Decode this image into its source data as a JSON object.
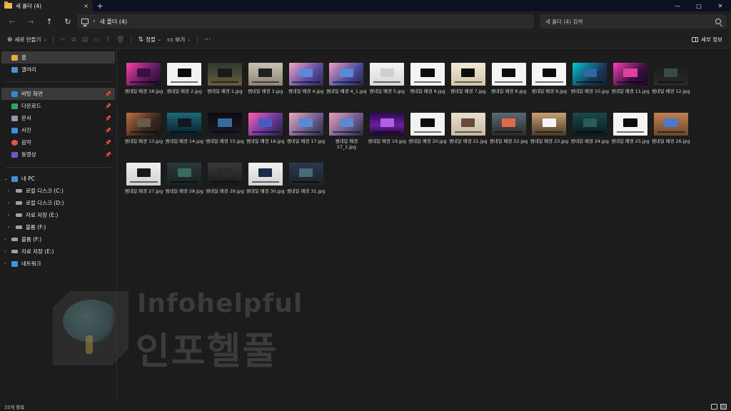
{
  "window": {
    "tab_title": "새 폴더 (4)",
    "tab_close": "×",
    "new_tab": "+",
    "minimize": "—",
    "maximize": "□",
    "close": "✕"
  },
  "address": {
    "back": "←",
    "forward": "→",
    "up": "↑",
    "refresh": "↻",
    "separator": "›",
    "crumb": "새 폴더 (4)",
    "search_placeholder": "새 폴더 (4) 검색"
  },
  "toolbar": {
    "new_label": "새로 만들기",
    "new_glyph": "⊕",
    "cut_glyph": "✂",
    "copy_glyph": "⧉",
    "paste_glyph": "▤",
    "rename_glyph": "▭",
    "share_glyph": "⇪",
    "delete_glyph": "🗑",
    "sort_label": "정렬",
    "sort_glyph": "⇅",
    "view_label": "보기",
    "view_glyph": "▭",
    "more": "···",
    "caret": "⌄",
    "details_label": "세부 정보"
  },
  "sidebar": {
    "home": "홈",
    "gallery": "갤러리",
    "desktop": "바탕 화면",
    "downloads": "다운로드",
    "documents": "문서",
    "pictures": "사진",
    "music": "음악",
    "videos": "동영상",
    "this_pc": "내 PC",
    "drive_c": "로컬 디스크 (C:)",
    "drive_d": "로컬 디스크 (D:)",
    "drive_e": "자료 저장 (E:)",
    "drive_f": "볼륨 (F:)",
    "drive_f2": "볼륨 (F:)",
    "drive_e2": "자료 저장 (E:)",
    "network": "네트워크",
    "pin": "📌",
    "chev_right": "›",
    "chev_down": "⌄",
    "colors": {
      "home": "#e8a848",
      "gallery": "#4a8fd6",
      "desktop": "#3a86d4",
      "downloads": "#2ea36b",
      "documents": "#8d9aa8",
      "pictures": "#3d8ed8",
      "music": "#e0584c",
      "videos": "#7a52c7",
      "pc": "#3f93d8",
      "drive": "#9aa3ad",
      "network": "#3f93d8"
    }
  },
  "files": [
    {
      "name": "썸네일 배경 18.jpg",
      "bg": "linear-gradient(135deg,#ff3fa8,#5a1a5e 60%,#1a0a20)",
      "screen": "#3a1040"
    },
    {
      "name": "썸네일 배경 2.jpg",
      "bg": "#f2f2f2",
      "screen": "#0c0c0c"
    },
    {
      "name": "썸네일 배경 1.jpg",
      "bg": "linear-gradient(180deg,#2b3a2e,#6b5b3e)",
      "screen": "#1a1a1a"
    },
    {
      "name": "썸네일 배경 3.jpg",
      "bg": "linear-gradient(180deg,#c9c2b3,#8c8474)",
      "screen": "#202020"
    },
    {
      "name": "썸네일 배경 4.jpg",
      "bg": "linear-gradient(135deg,#f4a8c6,#5a4aa0 60%,#2a2a4a)",
      "screen": "#5a8ad6"
    },
    {
      "name": "썸네일 배경 4_1.jpg",
      "bg": "linear-gradient(135deg,#f0a0c0,#4a4a9a 60%,#262646)",
      "screen": "#5a8ad6"
    },
    {
      "name": "썸네일 배경 5.jpg",
      "bg": "linear-gradient(180deg,#f4f4f4,#d8d8d8)",
      "screen": "#cfcfcf"
    },
    {
      "name": "썸네일 배경 6.jpg",
      "bg": "#f5f5f5",
      "screen": "#0c0c0c"
    },
    {
      "name": "썸네일 배경 7.jpg",
      "bg": "linear-gradient(180deg,#f0e8d8,#d4c4a8)",
      "screen": "#0c0c0c"
    },
    {
      "name": "썸네일 배경 8.jpg",
      "bg": "#f4f4f4",
      "screen": "#0c0c0c"
    },
    {
      "name": "썸네일 배경 9.jpg",
      "bg": "#f6f6f6",
      "screen": "#0c0c0c"
    },
    {
      "name": "썸네일 배경 10.jpg",
      "bg": "linear-gradient(135deg,#00c8d8,#1a3a5a 60%,#10202a)",
      "screen": "#2a6aa0"
    },
    {
      "name": "썸네일 배경 11.jpg",
      "bg": "linear-gradient(135deg,#ff3fb8,#3a1040 60%,#1a0a20)",
      "screen": "#e040a0"
    },
    {
      "name": "썸네일 배경 12.jpg",
      "bg": "linear-gradient(180deg,#1a1a1a,#2a2a2a)",
      "screen": "#3a4a4a"
    },
    {
      "name": "썸네일 배경 13.jpg",
      "bg": "linear-gradient(135deg,#c07040,#3a2a20 60%,#1a140e)",
      "screen": "#6a5a4a"
    },
    {
      "name": "썸네일 배경 14.jpg",
      "bg": "linear-gradient(180deg,#1a6a7a,#0a1a22)",
      "screen": "#101820"
    },
    {
      "name": "썸네일 배경 15.jpg",
      "bg": "linear-gradient(180deg,#0c0c10,#1a1a22)",
      "screen": "#3a6aa0"
    },
    {
      "name": "썸네일 배경 16.jpg",
      "bg": "linear-gradient(135deg,#ff60b0,#6a3a9a 55%,#22223a)",
      "screen": "#4a5ac0"
    },
    {
      "name": "썸네일 배경 17.jpg",
      "bg": "linear-gradient(135deg,#e8a8c0,#6a5a8a 60%,#2a2a3a)",
      "screen": "#5a8ad6"
    },
    {
      "name": "썸네일 배경 17_1.jpg",
      "bg": "linear-gradient(135deg,#e8a0b8,#6a5a8a 60%,#2a2a3a)",
      "screen": "#5a8ad6"
    },
    {
      "name": "썸네일 배경 19.jpg",
      "bg": "linear-gradient(180deg,#2a0a4a,#6a20a0 55%,#1a0a2a)",
      "screen": "#b060e0"
    },
    {
      "name": "썸네일 배경 20.jpg",
      "bg": "#f2f2f2",
      "screen": "#0c0c0c"
    },
    {
      "name": "썸네일 배경 21.jpg",
      "bg": "linear-gradient(180deg,#e8e0d0,#c8b8a0)",
      "screen": "#6a4a3a"
    },
    {
      "name": "썸네일 배경 22.jpg",
      "bg": "linear-gradient(180deg,#5a6a70,#2a2a2a)",
      "screen": "#e06a4a"
    },
    {
      "name": "썸네일 배경 23.jpg",
      "bg": "linear-gradient(180deg,#c8a070,#4a3a2a)",
      "screen": "#f4f4f4"
    },
    {
      "name": "썸네일 배경 24.jpg",
      "bg": "linear-gradient(180deg,#1a4a4a,#0a1a1a)",
      "screen": "#2a5a5a"
    },
    {
      "name": "썸네일 배경 25.jpg",
      "bg": "#f4f4f4",
      "screen": "#0c0c0c"
    },
    {
      "name": "썸네일 배경 26.jpg",
      "bg": "linear-gradient(180deg,#c08050,#6a4a30)",
      "screen": "#4a7ad0"
    },
    {
      "name": "썸네일 배경 27.jpg",
      "bg": "linear-gradient(180deg,#f0f0f0,#d0d0d0)",
      "screen": "#1a1a1a"
    },
    {
      "name": "썸네일 배경 28.jpg",
      "bg": "linear-gradient(180deg,#2a3a3a,#1a2020)",
      "screen": "#3a6a5a"
    },
    {
      "name": "썸네일 배경 29.jpg",
      "bg": "linear-gradient(180deg,#3a3a3a,#1a1a1a)",
      "screen": "#2a2a2a"
    },
    {
      "name": "썸네일 배경 30.jpg",
      "bg": "linear-gradient(180deg,#f0f0f0,#d4d4d4)",
      "screen": "#1a2a4a"
    },
    {
      "name": "썸네일 배경 31.jpg",
      "bg": "linear-gradient(180deg,#2a3a4a,#1a2228)",
      "screen": "#4a6a7a"
    }
  ],
  "watermark": {
    "line1": "Infohelpful",
    "line2": "인포헬풀"
  },
  "status": {
    "count": "33개 항목"
  }
}
